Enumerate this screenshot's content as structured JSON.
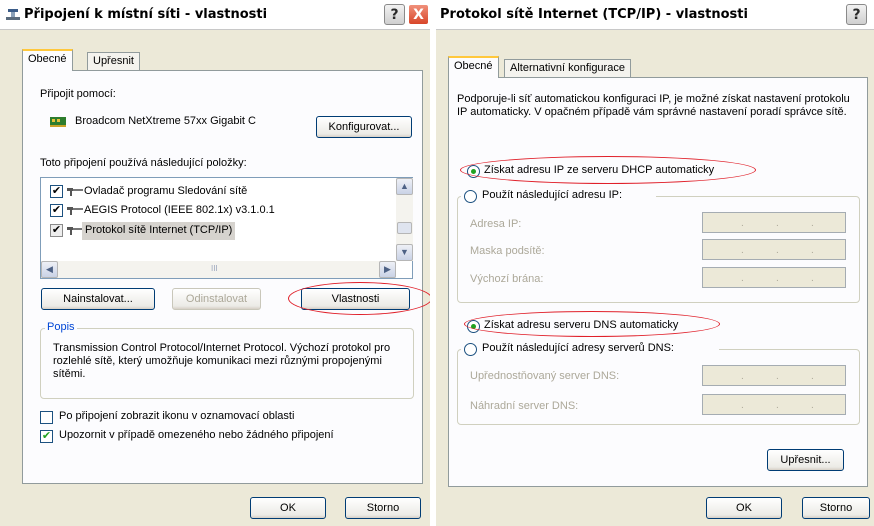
{
  "win1": {
    "title": "Připojení k místní síti - vlastnosti",
    "help_label": "?",
    "close_label": "X",
    "tabs": [
      "Obecné",
      "Upřesnit"
    ],
    "connect_using_label": "Připojit pomocí:",
    "adapter_name": "Broadcom NetXtreme 57xx Gigabit C",
    "configure_label": "Konfigurovat...",
    "items_label": "Toto připojení používá následující položky:",
    "items": [
      {
        "label": "Ovladač programu Sledování sítě",
        "checked": true
      },
      {
        "label": "AEGIS Protocol (IEEE 802.1x) v3.1.0.1",
        "checked": true
      },
      {
        "label": "Protokol sítě Internet (TCP/IP)",
        "checked": true
      }
    ],
    "scroll_mid": "III",
    "install_label": "Nainstalovat...",
    "uninstall_label": "Odinstalovat",
    "properties_label": "Vlastnosti",
    "description_legend": "Popis",
    "description_text": "Transmission Control Protocol/Internet Protocol. Výchozí protokol pro rozlehlé sítě, který umožňuje komunikaci mezi různými propojenými sítěmi.",
    "show_icon_label": "Po připojení zobrazit ikonu v oznamovací oblasti",
    "show_icon_checked": false,
    "notify_label": "Upozornit v případě omezeného nebo žádného připojení",
    "notify_checked": true,
    "ok_label": "OK",
    "cancel_label": "Storno"
  },
  "win2": {
    "title": "Protokol sítě Internet (TCP/IP) - vlastnosti",
    "help_label": "?",
    "tabs": [
      "Obecné",
      "Alternativní konfigurace"
    ],
    "intro_text": "Podporuje-li síť automatickou konfiguraci IP, je možné získat nastavení protokolu IP automaticky. V opačném případě vám správné nastavení poradí správce sítě.",
    "auto_ip_label": "Získat adresu IP ze serveru DHCP automaticky",
    "manual_ip_label": "Použít následující adresu IP:",
    "ip_address_label": "Adresa IP:",
    "subnet_label": "Maska podsítě:",
    "gateway_label": "Výchozí brána:",
    "auto_dns_label": "Získat adresu serveru DNS automaticky",
    "manual_dns_label": "Použít následující adresy serverů DNS:",
    "preferred_dns_label": "Upřednostňovaný server DNS:",
    "alternate_dns_label": "Náhradní server DNS:",
    "advanced_label": "Upřesnit...",
    "ok_label": "OK",
    "cancel_label": "Storno",
    "dot": "."
  },
  "colors": {
    "highlight_ellipse": "#e0202a",
    "check_green": "#21a121",
    "tab_accent": "#ffc83c"
  }
}
